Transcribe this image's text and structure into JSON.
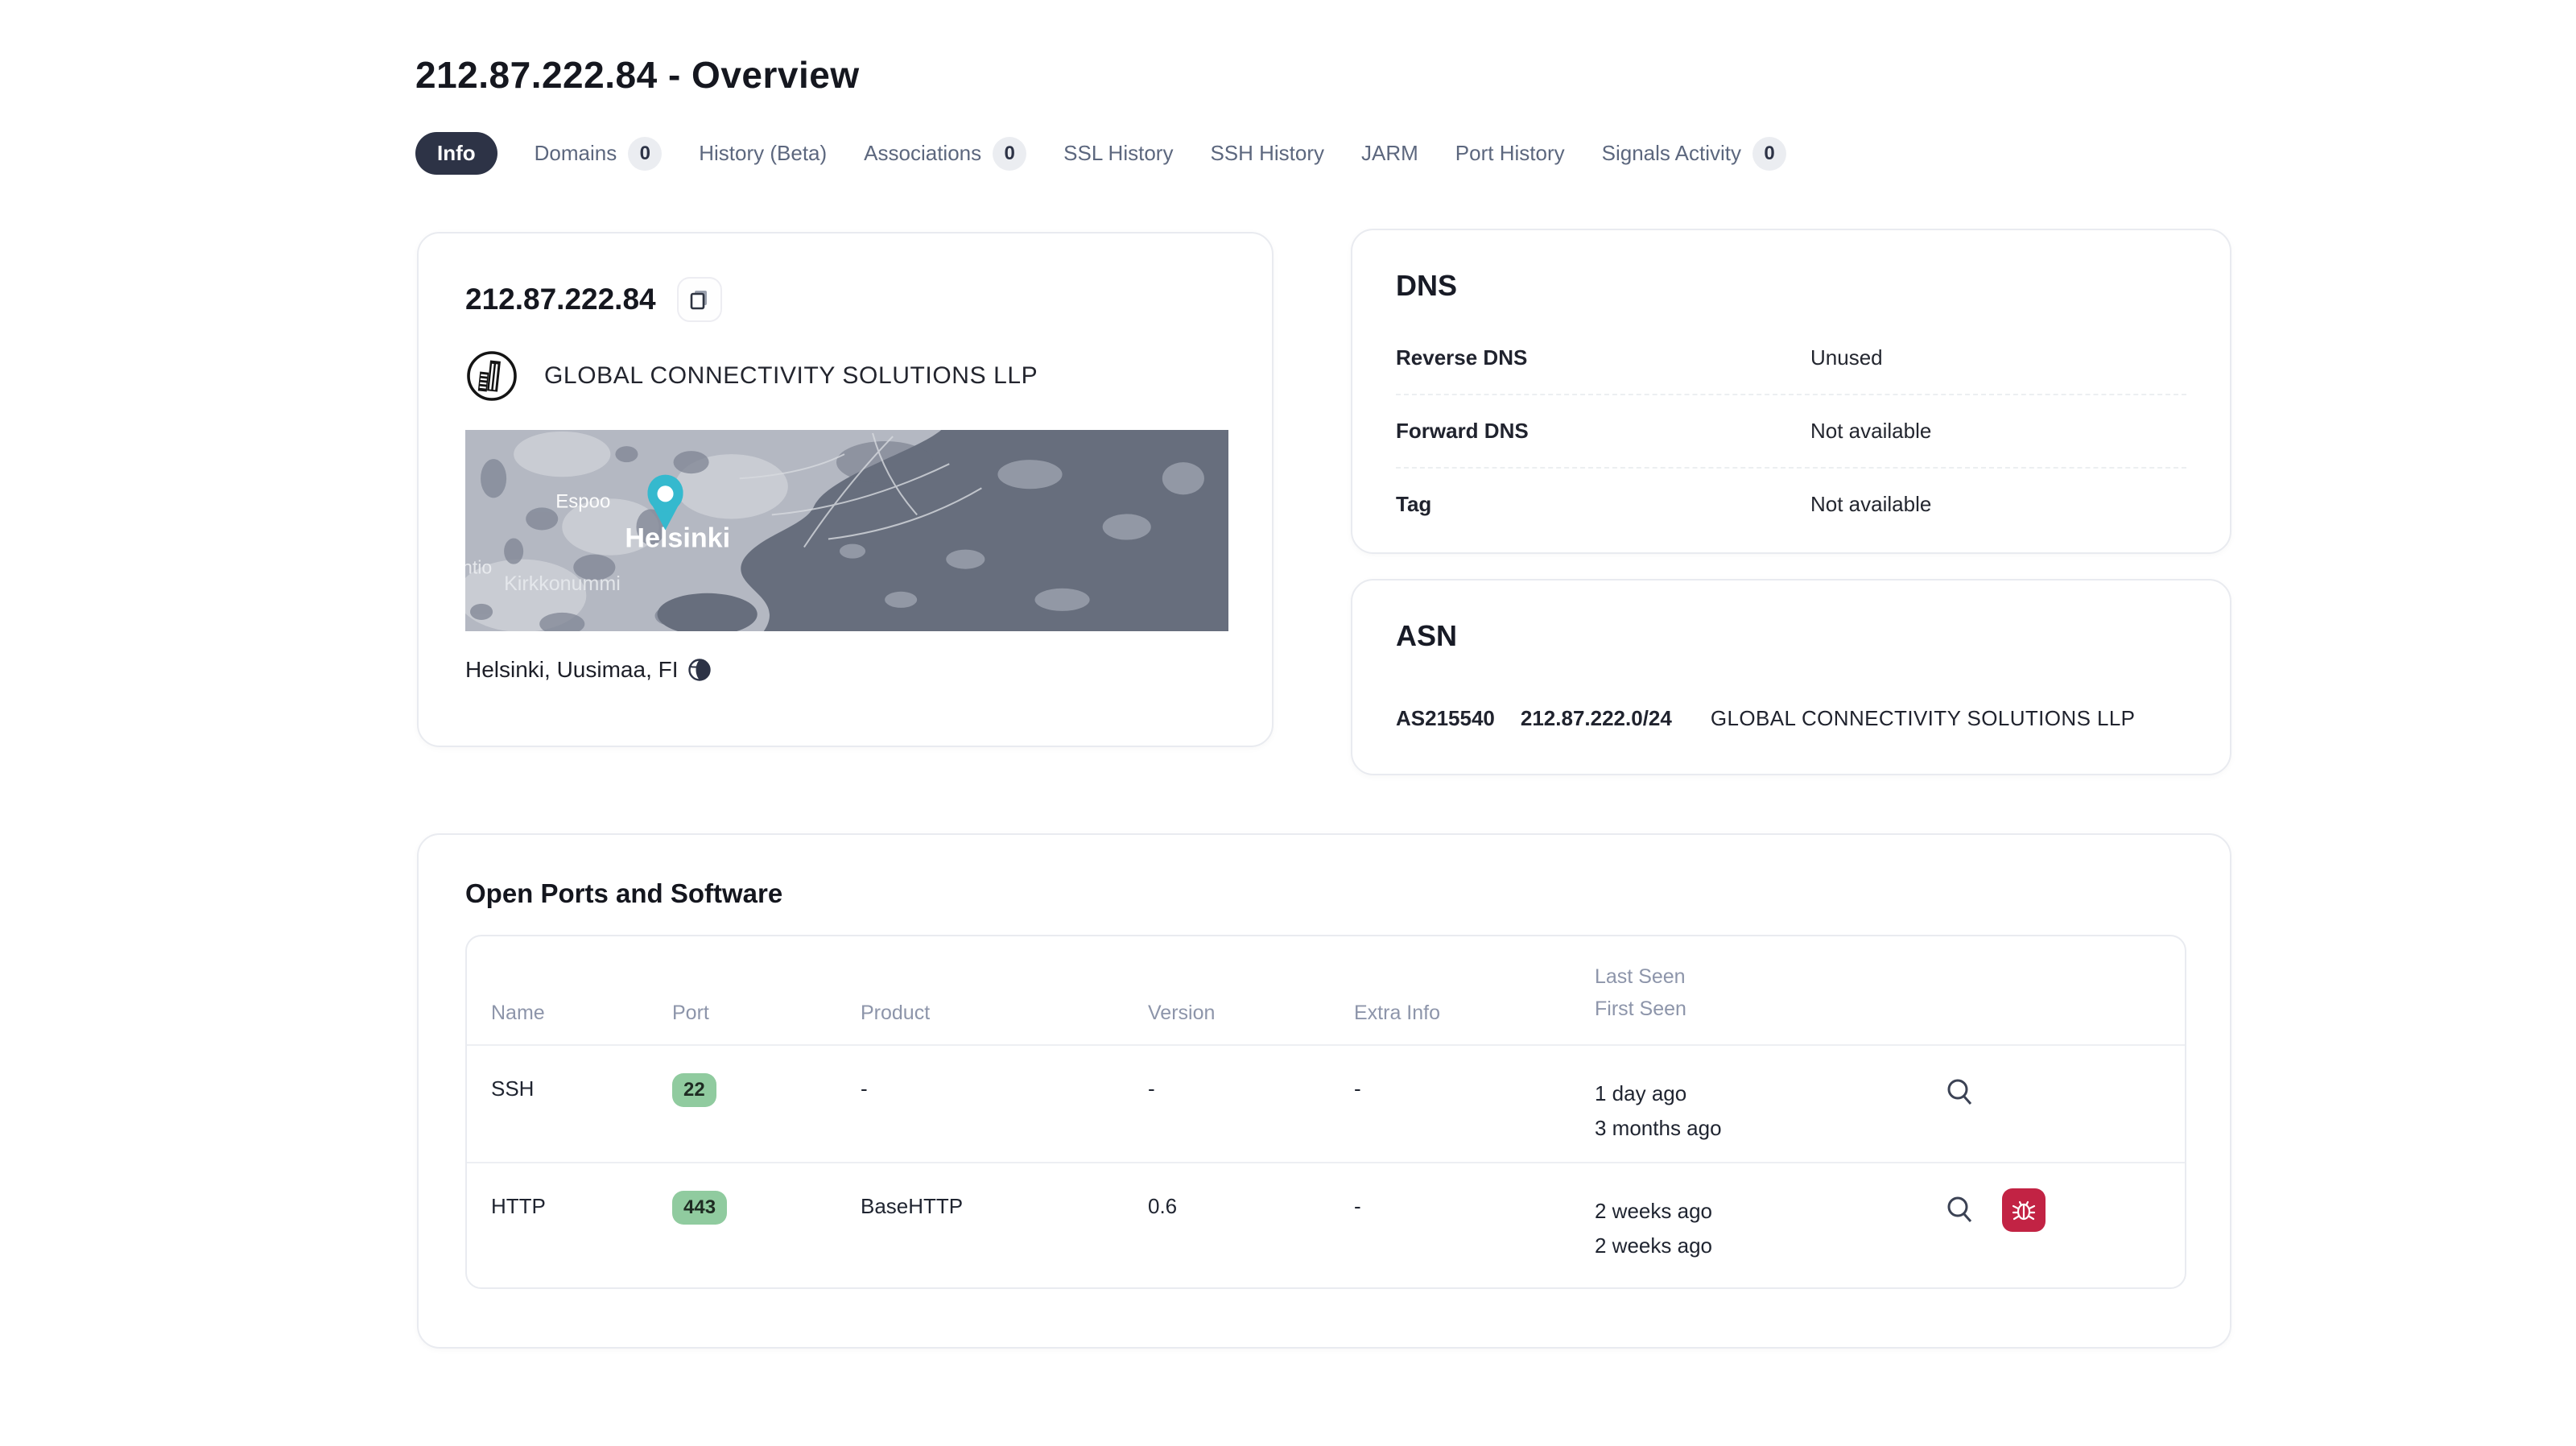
{
  "page": {
    "title": "212.87.222.84 - Overview"
  },
  "tabs": [
    {
      "label": "Info",
      "active": true
    },
    {
      "label": "Domains",
      "badge": "0"
    },
    {
      "label": "History (Beta)"
    },
    {
      "label": "Associations",
      "badge": "0"
    },
    {
      "label": "SSL History"
    },
    {
      "label": "SSH History"
    },
    {
      "label": "JARM"
    },
    {
      "label": "Port History"
    },
    {
      "label": "Signals Activity",
      "badge": "0"
    }
  ],
  "ip_card": {
    "ip": "212.87.222.84",
    "org": "GLOBAL CONNECTIVITY SOLUTIONS LLP",
    "location": "Helsinki, Uusimaa, FI",
    "map_labels": {
      "city": "Helsinki",
      "town1": "Espoo",
      "town2": "Kirkkonummi",
      "town3": "ntio"
    }
  },
  "dns_card": {
    "title": "DNS",
    "rows": [
      {
        "label": "Reverse DNS",
        "value": "Unused"
      },
      {
        "label": "Forward DNS",
        "value": "Not available"
      },
      {
        "label": "Tag",
        "value": "Not available"
      }
    ]
  },
  "asn_card": {
    "title": "ASN",
    "asn": "AS215540",
    "cidr": "212.87.222.0/24",
    "org": "GLOBAL CONNECTIVITY SOLUTIONS LLP"
  },
  "ports_section": {
    "title": "Open Ports and Software",
    "headers": {
      "name": "Name",
      "port": "Port",
      "product": "Product",
      "version": "Version",
      "extra": "Extra Info",
      "seen_line1": "Last Seen",
      "seen_line2": "First Seen"
    },
    "rows": [
      {
        "name": "SSH",
        "port": "22",
        "product": "-",
        "version": "-",
        "extra": "-",
        "last_seen": "1 day ago",
        "first_seen": "3 months ago",
        "vulnerable": false
      },
      {
        "name": "HTTP",
        "port": "443",
        "product": "BaseHTTP",
        "version": "0.6",
        "extra": "-",
        "last_seen": "2 weeks ago",
        "first_seen": "2 weeks ago",
        "vulnerable": true
      }
    ]
  },
  "colors": {
    "active_tab_bg": "#2d3346",
    "port_badge_bg": "#90cb9f",
    "vuln_red": "#c22344",
    "pin_teal": "#35b9ce"
  }
}
